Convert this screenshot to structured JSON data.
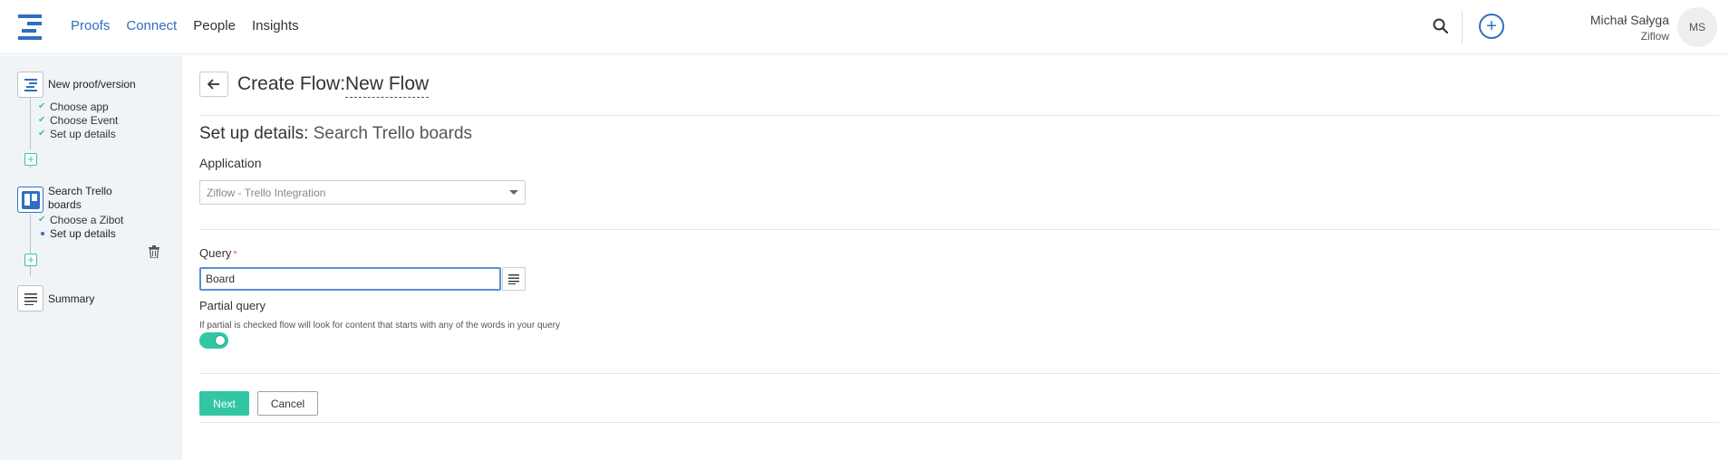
{
  "nav": {
    "items": [
      {
        "label": "Proofs",
        "active": true
      },
      {
        "label": "Connect",
        "active": true
      },
      {
        "label": "People",
        "active": false
      },
      {
        "label": "Insights",
        "active": false
      }
    ]
  },
  "user": {
    "name": "Michał Sałyga",
    "org": "Ziflow",
    "initials": "MS"
  },
  "sidebar": {
    "steps": [
      {
        "title": "New proof/version",
        "substeps": [
          "Choose app",
          "Choose Event",
          "Set up details"
        ]
      },
      {
        "title": "Search Trello boards",
        "substeps": [
          "Choose a Zibot",
          "Set up details"
        ]
      },
      {
        "title": "Summary"
      }
    ]
  },
  "page": {
    "title": "Create Flow:",
    "flow_name": "New Flow",
    "section_title": "Set up details:",
    "section_subtitle": "Search Trello boards"
  },
  "form": {
    "application_label": "Application",
    "application_value": "Ziflow - Trello Integration",
    "query_label": "Query",
    "query_required": "*",
    "query_value": "Board",
    "partial_label": "Partial query",
    "partial_help": "If partial is checked flow will look for content that starts with any of the words in your query",
    "partial_enabled": true
  },
  "actions": {
    "next": "Next",
    "cancel": "Cancel"
  },
  "colors": {
    "accent": "#2f6fc0",
    "success": "#33c6a5",
    "sidebar_bg": "#f1f4f6"
  }
}
